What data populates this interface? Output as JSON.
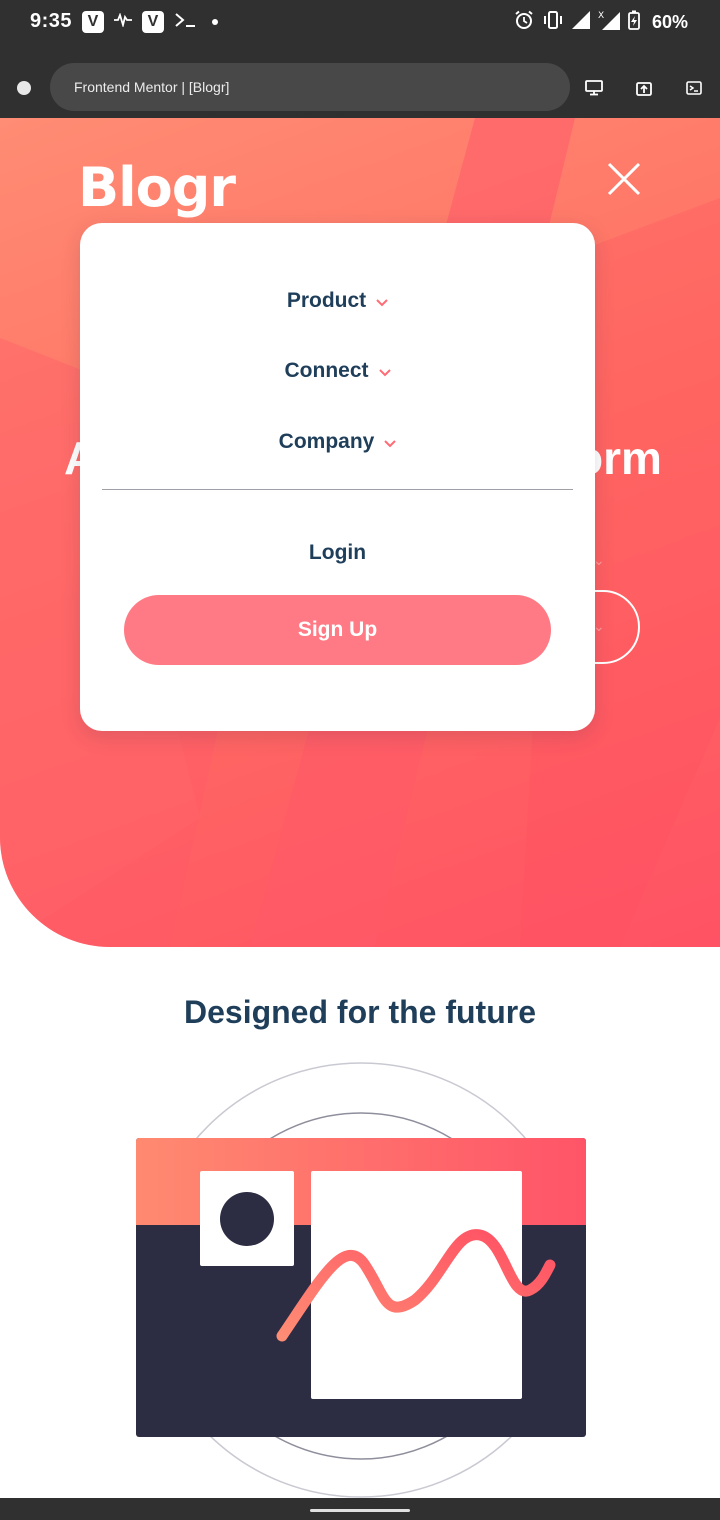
{
  "status_bar": {
    "time": "9:35",
    "battery": "60%",
    "icons_left": [
      "vivaldi-icon",
      "waveform-icon",
      "vivaldi-icon",
      "terminal-icon",
      "dot-icon"
    ],
    "icons_right": [
      "alarm-icon",
      "vibrate-icon",
      "signal-icon",
      "signal-x-icon",
      "battery-charging-icon"
    ]
  },
  "browser": {
    "url_title": "Frontend Mentor | [Blogr]",
    "icons": [
      "favicon",
      "desktop-icon",
      "share-icon",
      "console-icon"
    ]
  },
  "hero": {
    "logo": "Blogr",
    "heading_left": "A",
    "heading_right": "orm"
  },
  "menu": {
    "items": [
      {
        "label": "Product"
      },
      {
        "label": "Connect"
      },
      {
        "label": "Company"
      }
    ],
    "login": "Login",
    "signup": "Sign Up"
  },
  "section": {
    "title": "Designed for the future"
  },
  "colors": {
    "accent": "#ff7a84",
    "navy": "#1f3e5a",
    "hero_start": "#ff8c74",
    "hero_end": "#ff5264",
    "dark_panel": "#2c2d42"
  }
}
